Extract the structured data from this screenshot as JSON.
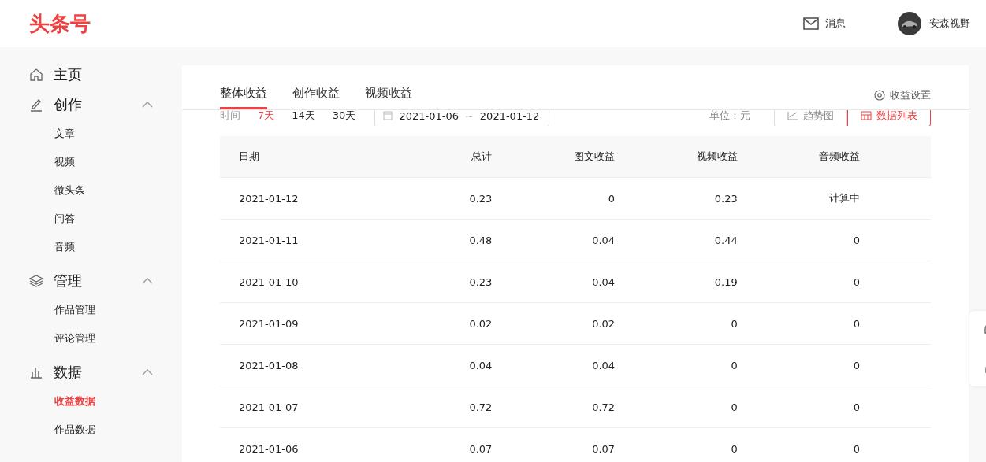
{
  "header": {
    "logo": "头条号",
    "messages": "消息",
    "user": "安森视野"
  },
  "sidebar": {
    "groups": [
      {
        "label": "主页"
      },
      {
        "label": "创作",
        "expanded": true,
        "children": [
          {
            "label": "文章",
            "selected": false
          },
          {
            "label": "视频",
            "selected": false
          },
          {
            "label": "微头条",
            "selected": false
          },
          {
            "label": "问答",
            "selected": false
          },
          {
            "label": "音频",
            "selected": false
          }
        ]
      },
      {
        "label": "管理",
        "expanded": true,
        "children": [
          {
            "label": "作品管理",
            "selected": false
          },
          {
            "label": "评论管理",
            "selected": false
          }
        ]
      },
      {
        "label": "数据",
        "expanded": true,
        "children": [
          {
            "label": "收益数据",
            "selected": true
          },
          {
            "label": "作品数据",
            "selected": false
          }
        ]
      }
    ]
  },
  "tabs": [
    {
      "label": "整体收益",
      "selected": true
    },
    {
      "label": "创作收益",
      "selected": false
    },
    {
      "label": "视频收益",
      "selected": false
    }
  ],
  "settings": "收益设置",
  "filter": {
    "label": "时间",
    "ranges": [
      {
        "label": "7天",
        "selected": true
      },
      {
        "label": "14天",
        "selected": false
      },
      {
        "label": "30天",
        "selected": false
      }
    ],
    "start": "2021-01-06",
    "separator": "~",
    "end": "2021-01-12",
    "unit": "单位：元",
    "views": [
      {
        "label": "趋势图",
        "selected": false
      },
      {
        "label": "数据列表",
        "selected": true
      }
    ]
  },
  "table": {
    "columns": [
      "日期",
      "总计",
      "图文收益",
      "视频收益",
      "音频收益"
    ],
    "rows": [
      [
        "2021-01-12",
        "0.23",
        "0",
        "0.23",
        "计算中"
      ],
      [
        "2021-01-11",
        "0.48",
        "0.04",
        "0.44",
        "0"
      ],
      [
        "2021-01-10",
        "0.23",
        "0.04",
        "0.19",
        "0"
      ],
      [
        "2021-01-09",
        "0.02",
        "0.02",
        "0",
        "0"
      ],
      [
        "2021-01-08",
        "0.04",
        "0.04",
        "0",
        "0"
      ],
      [
        "2021-01-07",
        "0.72",
        "0.72",
        "0",
        "0"
      ],
      [
        "2021-01-06",
        "0.07",
        "0.07",
        "0",
        "0"
      ]
    ]
  }
}
